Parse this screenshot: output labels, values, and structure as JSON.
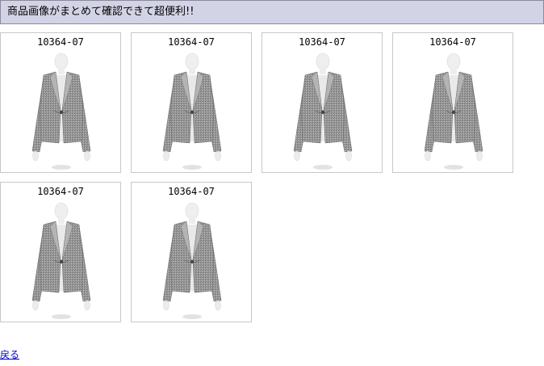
{
  "header": {
    "title": "商品画像がまとめて確認できて超便利!!"
  },
  "products": [
    {
      "code": "10364-07",
      "image": "gray-tweed-jacket-on-mannequin"
    },
    {
      "code": "10364-07",
      "image": "gray-tweed-jacket-on-mannequin"
    },
    {
      "code": "10364-07",
      "image": "gray-tweed-jacket-on-mannequin"
    },
    {
      "code": "10364-07",
      "image": "gray-tweed-jacket-on-mannequin"
    },
    {
      "code": "10364-07",
      "image": "gray-tweed-jacket-on-mannequin"
    },
    {
      "code": "10364-07",
      "image": "gray-tweed-jacket-on-mannequin"
    }
  ],
  "footer": {
    "back_label": "戻る"
  },
  "colors": {
    "header_bg": "#d3d3e6",
    "link": "#0000cc",
    "card_border": "#c8c8c8"
  }
}
